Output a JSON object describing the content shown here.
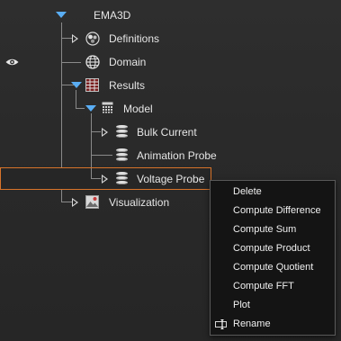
{
  "tree": {
    "root_label": "EMA3D",
    "definitions_label": "Definitions",
    "domain_label": "Domain",
    "results_label": "Results",
    "model_label": "Model",
    "bulk_current_label": "Bulk Current",
    "animation_probe_label": "Animation Probe",
    "voltage_probe_label": "Voltage Probe",
    "visualization_label": "Visualization"
  },
  "context_menu": {
    "items": [
      "Delete",
      "Compute Difference",
      "Compute Sum",
      "Compute Product",
      "Compute Quotient",
      "Compute FFT",
      "Plot",
      "Rename"
    ]
  },
  "colors": {
    "background": "#2a2a2a",
    "selection_border": "#d8742a",
    "expand_arrow": "#5aaef5",
    "menu_background": "#141414"
  }
}
